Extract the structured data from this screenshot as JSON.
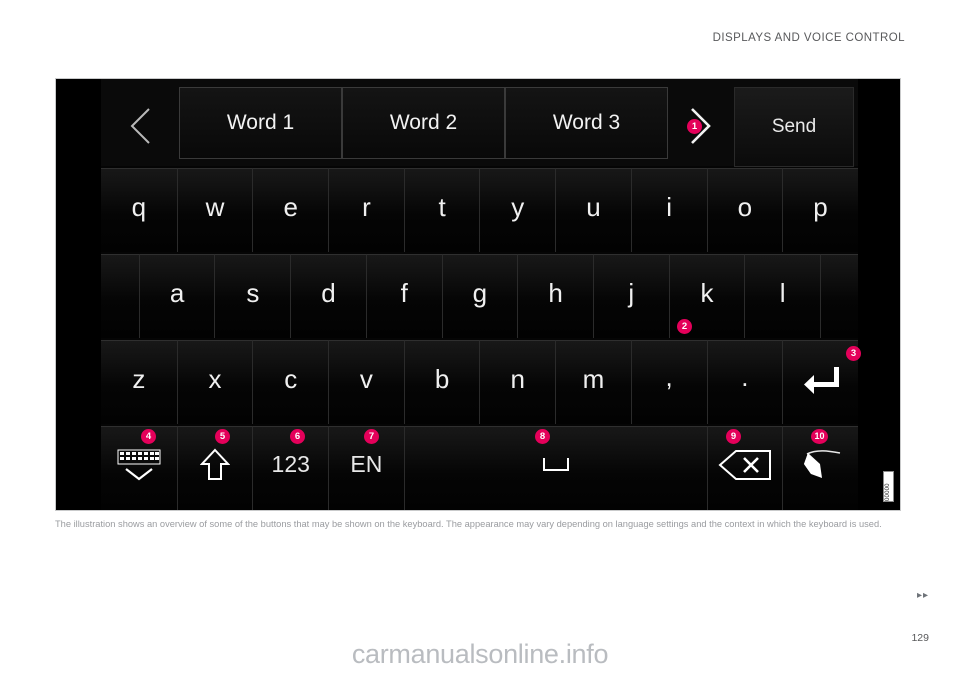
{
  "header": {
    "title": "DISPLAYS AND VOICE CONTROL"
  },
  "illustration": {
    "image_id": "00000",
    "topbar": {
      "prev_icon": "chevron-left-icon",
      "next_icon": "chevron-right-icon",
      "suggestions": [
        {
          "label": "Word 1"
        },
        {
          "label": "Word 2"
        },
        {
          "label": "Word 3"
        }
      ],
      "send_label": "Send"
    },
    "keyboard": {
      "row1": [
        "q",
        "w",
        "e",
        "r",
        "t",
        "y",
        "u",
        "i",
        "o",
        "p"
      ],
      "row2": [
        "",
        "a",
        "s",
        "d",
        "f",
        "g",
        "h",
        "j",
        "k",
        "l",
        ""
      ],
      "row3": [
        "z",
        "x",
        "c",
        "v",
        "b",
        "n",
        "m",
        ",",
        ".",
        "enter"
      ],
      "row4": [
        {
          "name": "hide-keyboard",
          "label": "",
          "icon": "keyboard-down-icon"
        },
        {
          "name": "shift",
          "label": "",
          "icon": "shift-arrow-icon"
        },
        {
          "name": "numbers",
          "label": "123",
          "icon": ""
        },
        {
          "name": "language",
          "label": "EN",
          "icon": ""
        },
        {
          "name": "space",
          "label": "",
          "icon": "space-bar-icon"
        },
        {
          "name": "backspace",
          "label": "",
          "icon": "backspace-x-icon"
        },
        {
          "name": "handwriting",
          "label": "",
          "icon": "handwriting-pen-icon"
        }
      ]
    },
    "callouts": [
      {
        "num": "1"
      },
      {
        "num": "2"
      },
      {
        "num": "3"
      },
      {
        "num": "4"
      },
      {
        "num": "5"
      },
      {
        "num": "6"
      },
      {
        "num": "7"
      },
      {
        "num": "8"
      },
      {
        "num": "9"
      },
      {
        "num": "10"
      }
    ]
  },
  "caption": "The illustration shows an overview of some of the buttons that may be shown on the keyboard. The appearance may vary depending on language settings and the context in which the keyboard is used.",
  "footer": {
    "arrows": "▸▸",
    "page_number": "129",
    "watermark": "carmanualsonline.info"
  },
  "colors": {
    "callout": "#e4005a",
    "header_text": "#58595b",
    "caption_text": "#9a9ca0",
    "screen_bg": "#050505"
  }
}
